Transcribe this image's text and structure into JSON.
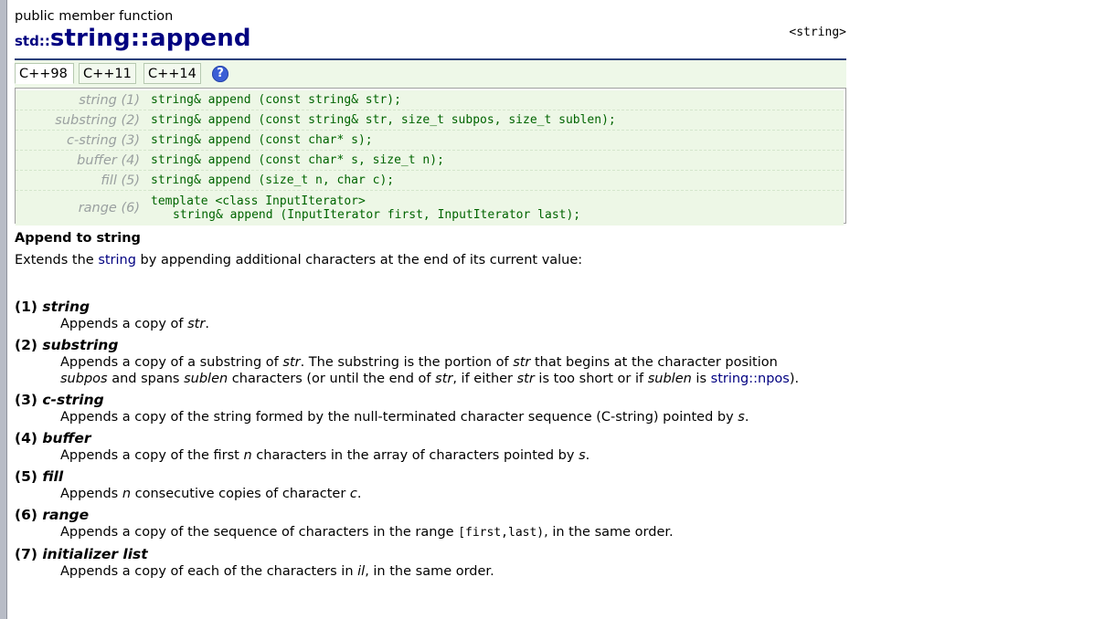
{
  "page": {
    "kind": "public member function",
    "title_ns": "std::",
    "title_name": "string::append",
    "header": "<string>"
  },
  "tabs": [
    "C++98",
    "C++11",
    "C++14"
  ],
  "help_icon_glyph": "?",
  "prototypes": [
    {
      "label": "string (1)",
      "code": "string& append (const string& str);"
    },
    {
      "label": "substring (2)",
      "code": "string& append (const string& str, size_t subpos, size_t sublen);"
    },
    {
      "label": "c-string (3)",
      "code": "string& append (const char* s);"
    },
    {
      "label": "buffer (4)",
      "code": "string& append (const char* s, size_t n);"
    },
    {
      "label": "fill (5)",
      "code": "string& append (size_t n, char c);"
    },
    {
      "label": "range (6)",
      "code_line1": "template <class InputIterator>",
      "code_line2": "string& append (InputIterator first, InputIterator last);"
    }
  ],
  "description": {
    "title": "Append to string",
    "p1_before": "Extends the ",
    "p1_link": "string",
    "p1_after": " by appending additional characters at the end of its current value:"
  },
  "definitions": {
    "d1": {
      "num": "(1)",
      "name": "string",
      "t1": "Appends a copy of ",
      "t2": "str",
      "t3": "."
    },
    "d2": {
      "num": "(2)",
      "name": "substring",
      "l1a": "Appends a copy of a substring of ",
      "l1b": "str",
      "l1c": ". The substring is the portion of ",
      "l1d": "str",
      "l1e": " that begins at the character position",
      "l2a": "subpos",
      "l2b": " and spans ",
      "l2c": "sublen",
      "l2d": " characters (or until the end of ",
      "l2e": "str",
      "l2f": ", if either ",
      "l2g": "str",
      "l2h": " is too short or if ",
      "l2i": "sublen",
      "l2j": " is ",
      "l2k": "string::npos",
      "l2l": ")."
    },
    "d3": {
      "num": "(3)",
      "name": "c-string",
      "t1": "Appends a copy of the string formed by the null-terminated character sequence (C-string) pointed by ",
      "t2": "s",
      "t3": "."
    },
    "d4": {
      "num": "(4)",
      "name": "buffer",
      "t1": "Appends a copy of the first ",
      "t2": "n",
      "t3": " characters in the array of characters pointed by ",
      "t4": "s",
      "t5": "."
    },
    "d5": {
      "num": "(5)",
      "name": "fill",
      "t1": "Appends ",
      "t2": "n",
      "t3": " consecutive copies of character ",
      "t4": "c",
      "t5": "."
    },
    "d6": {
      "num": "(6)",
      "name": "range",
      "t1": "Appends a copy of the sequence of characters in the range ",
      "t2": "[first,last)",
      "t3": ", in the same order."
    },
    "d7": {
      "num": "(7)",
      "name": "initializer list",
      "t1": "Appends a copy of each of the characters in ",
      "t2": "il",
      "t3": ", in the same order."
    }
  }
}
